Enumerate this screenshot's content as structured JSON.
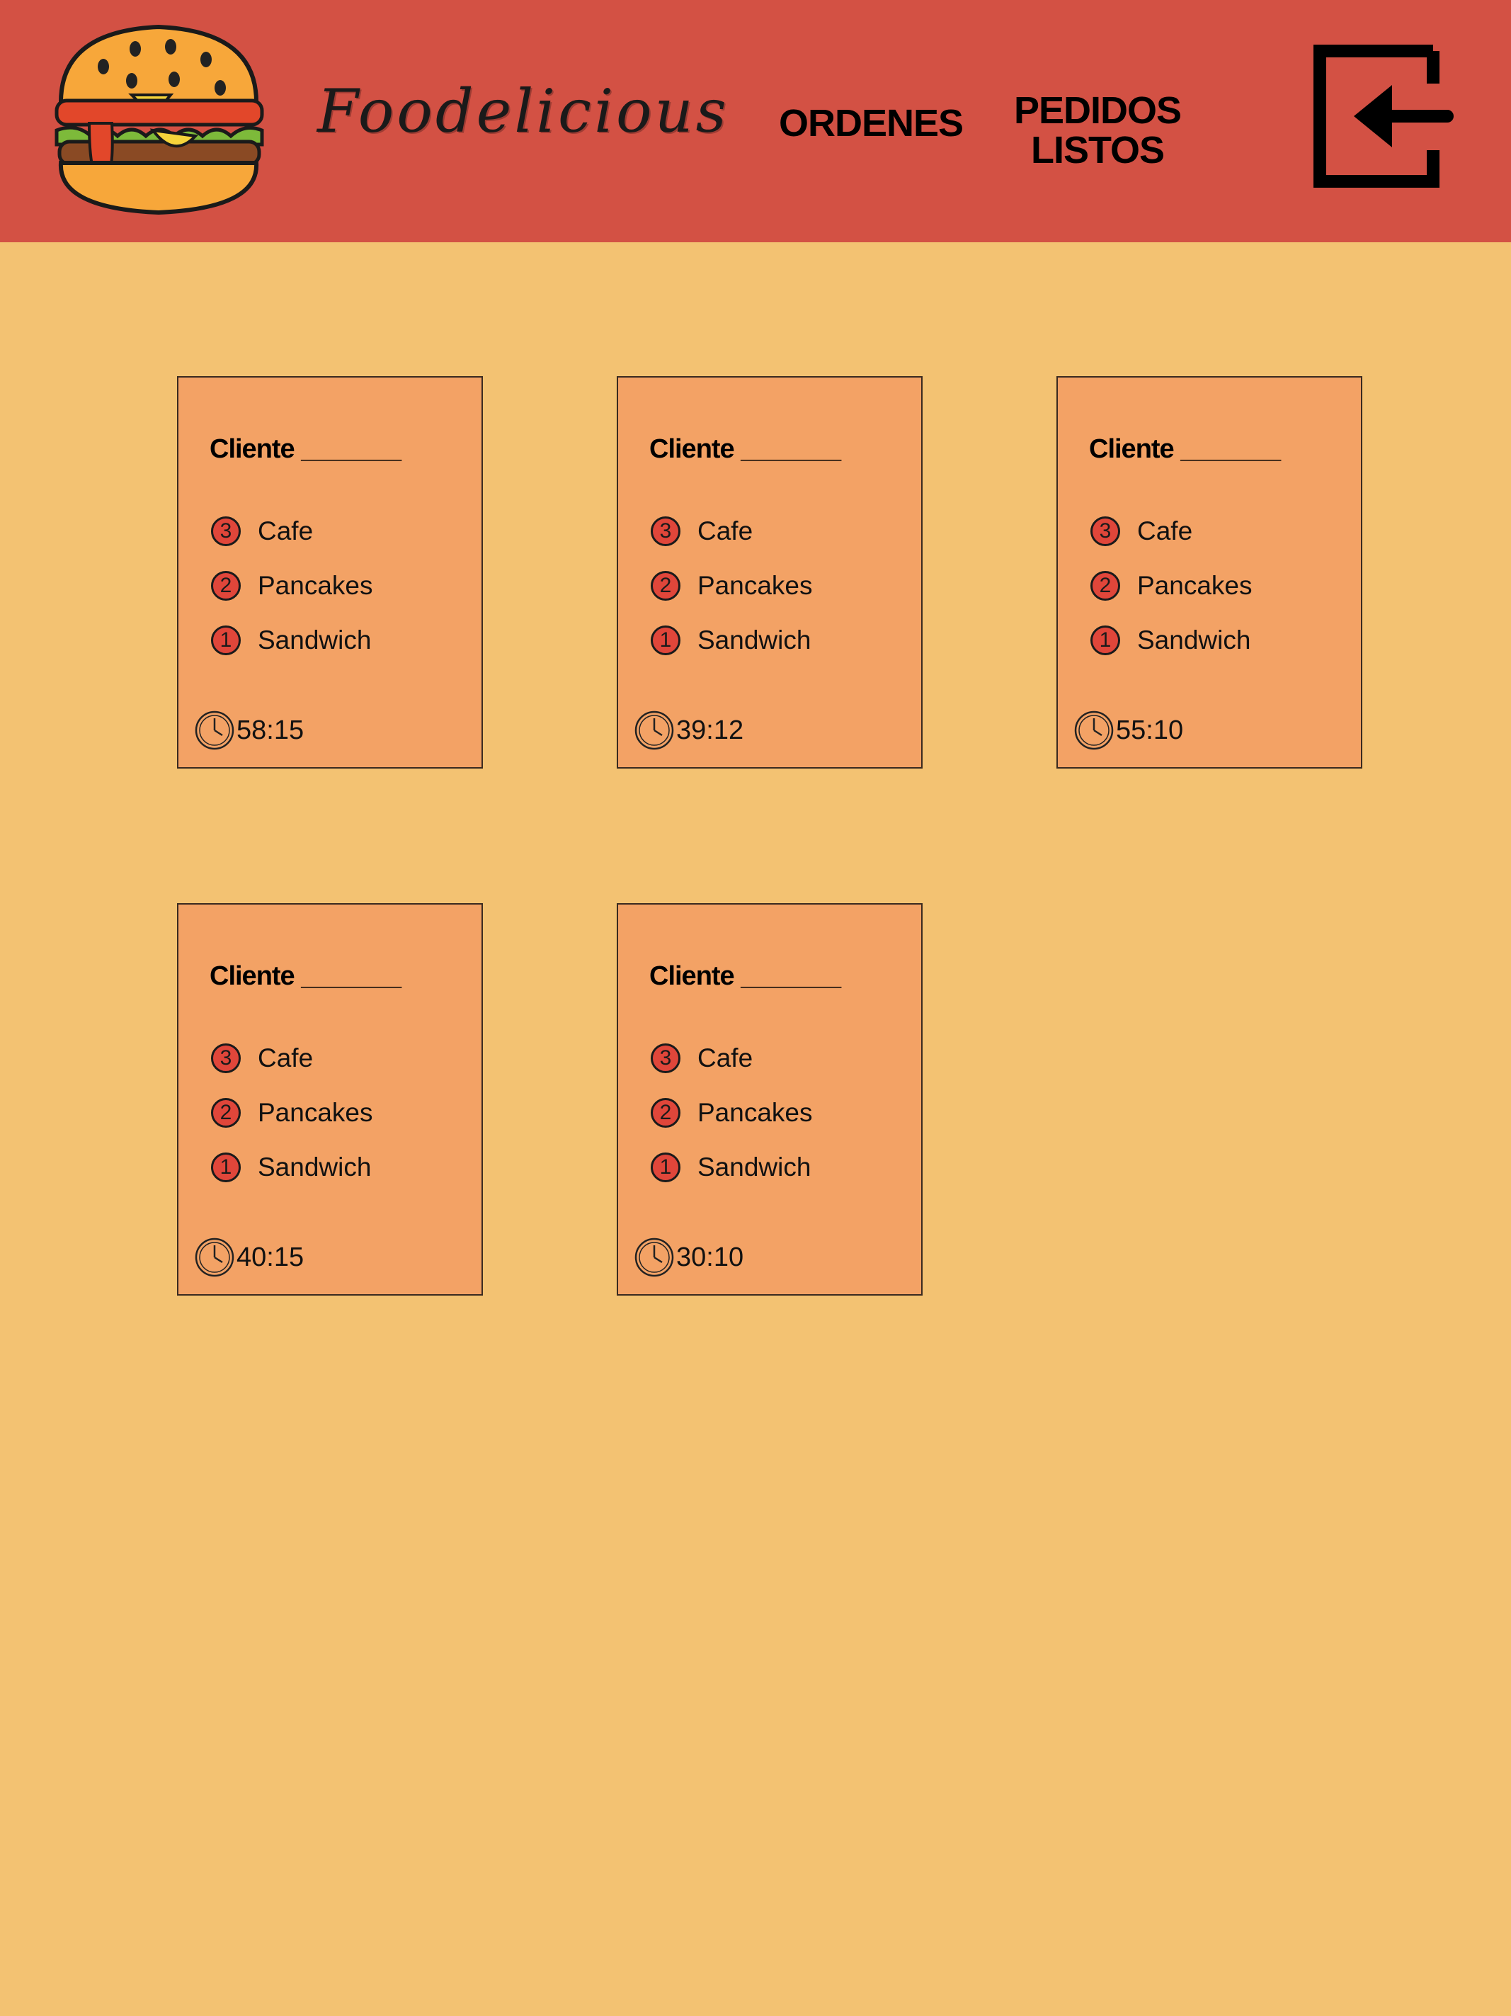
{
  "header": {
    "brand": "Foodelicious",
    "nav": [
      "ORDENES",
      "PEDIDOS\nLISTOS"
    ],
    "logo_icon": "burger-logo",
    "logout_icon": "logout-icon",
    "bg_color": "#D35144"
  },
  "colors": {
    "page_bg": "#F3C272",
    "card_bg": "#F3A265",
    "qty_badge": "#E0463A"
  },
  "orders": [
    {
      "title": "Cliente _______",
      "items": [
        {
          "qty": "3",
          "name": "Cafe"
        },
        {
          "qty": "2",
          "name": "Pancakes"
        },
        {
          "qty": "1",
          "name": "Sandwich"
        }
      ],
      "timer": "58:15"
    },
    {
      "title": "Cliente _______",
      "items": [
        {
          "qty": "3",
          "name": "Cafe"
        },
        {
          "qty": "2",
          "name": "Pancakes"
        },
        {
          "qty": "1",
          "name": "Sandwich"
        }
      ],
      "timer": "39:12"
    },
    {
      "title": "Cliente _______",
      "items": [
        {
          "qty": "3",
          "name": "Cafe"
        },
        {
          "qty": "2",
          "name": "Pancakes"
        },
        {
          "qty": "1",
          "name": "Sandwich"
        }
      ],
      "timer": "55:10"
    },
    {
      "title": "Cliente _______",
      "items": [
        {
          "qty": "3",
          "name": "Cafe"
        },
        {
          "qty": "2",
          "name": "Pancakes"
        },
        {
          "qty": "1",
          "name": "Sandwich"
        }
      ],
      "timer": "40:15"
    },
    {
      "title": "Cliente _______",
      "items": [
        {
          "qty": "3",
          "name": "Cafe"
        },
        {
          "qty": "2",
          "name": "Pancakes"
        },
        {
          "qty": "1",
          "name": "Sandwich"
        }
      ],
      "timer": "30:10"
    }
  ]
}
